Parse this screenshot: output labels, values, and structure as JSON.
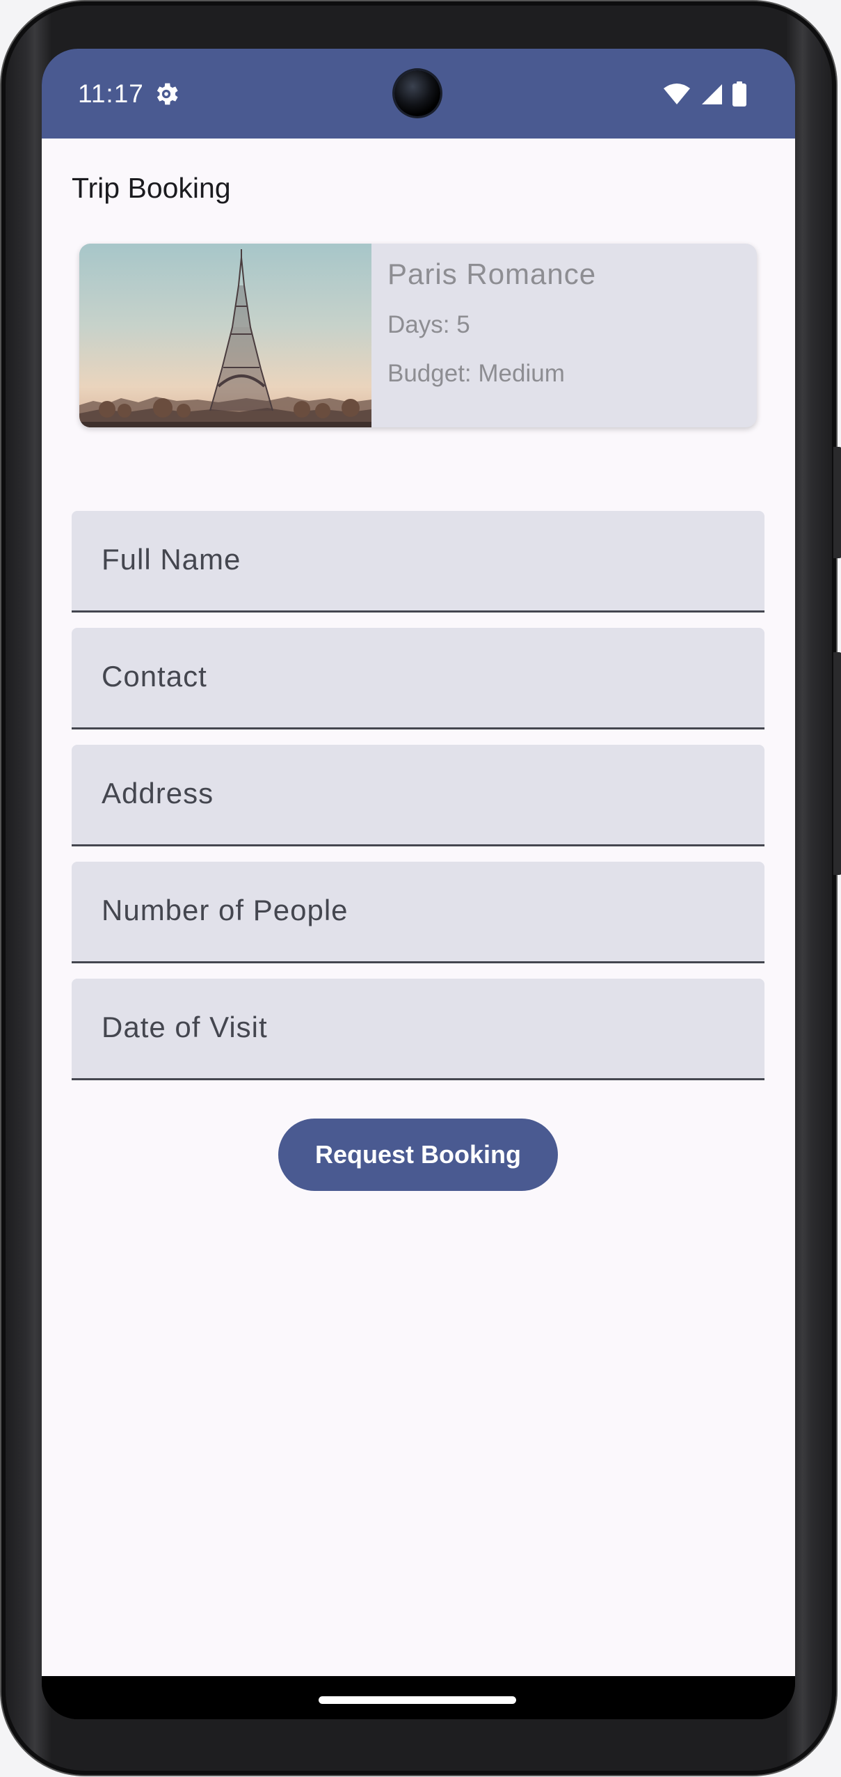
{
  "status_bar": {
    "time": "11:17",
    "settings_icon": "gear-icon",
    "wifi_icon": "wifi-icon",
    "signal_icon": "cellular-signal-icon",
    "battery_icon": "battery-icon",
    "background_color": "#4a5a91"
  },
  "header": {
    "title": "Trip Booking"
  },
  "trip_card": {
    "name": "Paris Romance",
    "days": "Days: 5",
    "budget": "Budget: Medium",
    "image": "eiffel-tower-photo"
  },
  "form": {
    "fields": [
      {
        "label": "Full Name"
      },
      {
        "label": "Contact"
      },
      {
        "label": "Address"
      },
      {
        "label": "Number of People"
      },
      {
        "label": "Date of Visit"
      }
    ],
    "submit_label": "Request Booking"
  },
  "colors": {
    "primary": "#4a5a91",
    "field_background": "#e1e1ea",
    "app_background": "#fbf8fc"
  }
}
